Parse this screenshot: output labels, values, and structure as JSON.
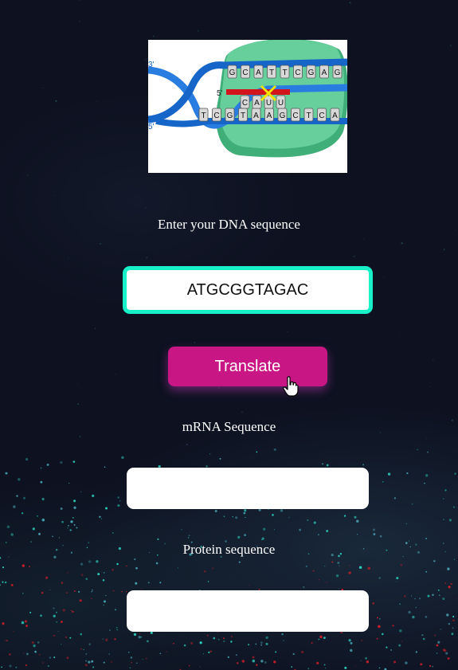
{
  "dna": {
    "label": "Enter your DNA sequence",
    "value": "ATGCGGTAGAC",
    "strand_labels": [
      "3'",
      "5'",
      "5'"
    ],
    "template_bases": [
      "G",
      "C",
      "A",
      "T",
      "T",
      "C",
      "G",
      "A",
      "G"
    ],
    "coding_bases": [
      "T",
      "C",
      "G",
      "T",
      "A",
      "A",
      "G",
      "C",
      "T",
      "C",
      "A"
    ],
    "rna_bases": [
      "C",
      "A",
      "U",
      "U"
    ]
  },
  "translate": {
    "label": "Translate"
  },
  "mrna": {
    "label": "mRNA Sequence",
    "value": ""
  },
  "protein": {
    "label": "Protein sequence",
    "value": ""
  },
  "colors": {
    "input_border": "#18f0c8",
    "button": "#c81784",
    "background": "#0d1120",
    "polymerase": "#5fcd98",
    "helix": "#1566c8"
  }
}
